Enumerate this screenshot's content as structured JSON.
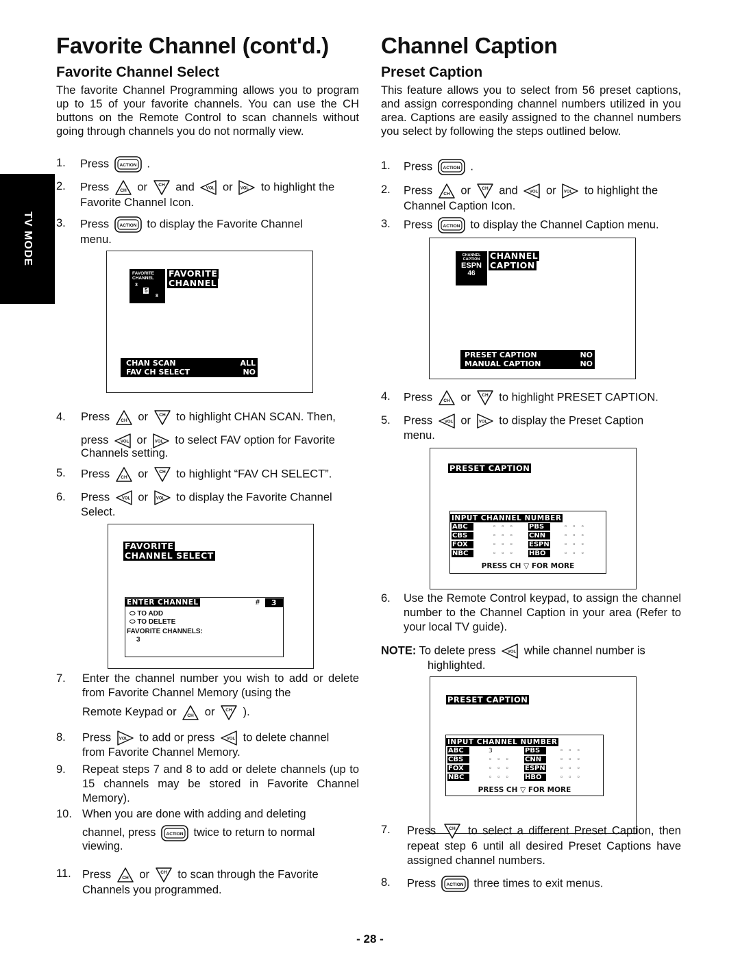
{
  "side_tab": {
    "label": "TV MODE"
  },
  "left": {
    "title": "Favorite Channel (cont'd.)",
    "subtitle": "Favorite Channel Select",
    "intro": "The favorite Channel Programming allows you to program up to 15 of your favorite channels. You can use the CH buttons on the Remote Control to scan channels without going through channels you do not normally view.",
    "steps": {
      "s1": {
        "num": "1.",
        "a": "Press",
        "b": "."
      },
      "s2": {
        "num": "2.",
        "a": "Press",
        "or1": "or",
        "and": "and",
        "or2": "or",
        "b": "to highlight the",
        "c": "Favorite Channel Icon."
      },
      "s3": {
        "num": "3.",
        "a": "Press",
        "b": "to display the Favorite Channel",
        "c": "menu."
      },
      "s4": {
        "num": "4.",
        "a": "Press",
        "or1": "or",
        "b": "to highlight CHAN SCAN. Then,",
        "c": "press",
        "or2": "or",
        "d": "to select FAV option for Favorite",
        "e": "Channels setting."
      },
      "s5": {
        "num": "5.",
        "a": "Press",
        "or1": "or",
        "b": "to highlight “FAV CH SELECT”."
      },
      "s6": {
        "num": "6.",
        "a": "Press",
        "or1": "or",
        "b": "to display the Favorite Channel",
        "c": "Select."
      },
      "s7": {
        "num": "7.",
        "a": "Enter the channel number you wish to add or delete from Favorite Channel Memory (using the",
        "b": "Remote Keypad or",
        "or1": "or",
        "c": ")."
      },
      "s8": {
        "num": "8.",
        "a": "Press",
        "b": "to add or press",
        "c": "to delete channel",
        "d": "from Favorite Channel Memory."
      },
      "s9": {
        "num": "9.",
        "a": "Repeat steps 7 and 8 to add or delete channels (up to 15 channels may be stored in Favorite Channel Memory)."
      },
      "s10": {
        "num": "10.",
        "a": "When you are done with adding and deleting",
        "b": "channel, press",
        "c": "twice to return to normal",
        "d": "viewing."
      },
      "s11": {
        "num": "11.",
        "a": "Press",
        "or1": "or",
        "b": "to scan through the Favorite",
        "c": "Channels you programmed."
      }
    },
    "screen1": {
      "icon_line1": "FAVORITE",
      "icon_line2": "CHANNEL",
      "icon_nums": [
        "3",
        "5",
        "8"
      ],
      "title_line1": "FAVORITE",
      "title_line2": "CHANNEL",
      "rows": [
        {
          "label": "CHAN SCAN",
          "value": "ALL"
        },
        {
          "label": "FAV CH SELECT",
          "value": "NO"
        }
      ]
    },
    "screen2": {
      "title_line1": "FAVORITE",
      "title_line2": "CHANNEL SELECT",
      "enter_label": "ENTER CHANNEL",
      "hash": "#",
      "channel": "3",
      "add_label": "TO ADD",
      "delete_label": "TO DELETE",
      "fav_label": "FAVORITE CHANNELS:",
      "fav_value": "3"
    }
  },
  "right": {
    "title": "Channel Caption",
    "subtitle": "Preset Caption",
    "intro": "This feature allows you to select from 56 preset captions, and assign corresponding channel numbers utilized in you area. Captions are easily assigned to the channel numbers you select by following the steps outlined below.",
    "steps": {
      "s1": {
        "num": "1.",
        "a": "Press",
        "b": "."
      },
      "s2": {
        "num": "2.",
        "a": "Press",
        "or1": "or",
        "and": "and",
        "or2": "or",
        "b": "to highlight the",
        "c": "Channel Caption Icon."
      },
      "s3": {
        "num": "3.",
        "a": "Press",
        "b": "to display the Channel Caption menu."
      },
      "s4": {
        "num": "4.",
        "a": "Press",
        "or1": "or",
        "b": "to highlight PRESET CAPTION."
      },
      "s5": {
        "num": "5.",
        "a": "Press",
        "or1": "or",
        "b": "to display the Preset Caption",
        "c": "menu."
      },
      "s6": {
        "num": "6.",
        "a": "Use the Remote Control keypad, to assign the channel number to the Channel Caption in your area (Refer to your local TV guide)."
      },
      "note": {
        "label": "NOTE:",
        "a": "To delete press",
        "b": "while channel number is",
        "c": "highlighted."
      },
      "s7": {
        "num": "7.",
        "a": "Press",
        "b": "to select a different Preset Caption,",
        "c": "then repeat step 6 until all desired Preset Captions have assigned channel numbers."
      },
      "s8": {
        "num": "8.",
        "a": "Press",
        "b": "three times to exit menus."
      }
    },
    "screen1": {
      "icon_line1": "CHANNEL",
      "icon_line2": "CAPTION",
      "icon_station": "ESPN",
      "icon_channel": "46",
      "title_line1": "CHANNEL",
      "title_line2": "CAPTION",
      "rows": [
        {
          "label": "PRESET CAPTION",
          "value": "NO"
        },
        {
          "label": "MANUAL CAPTION",
          "value": "NO"
        }
      ]
    },
    "screen2": {
      "title": "PRESET CAPTION",
      "table_header": "INPUT CHANNEL NUMBER",
      "left_col": [
        {
          "station": "ABC",
          "value": "◦◦◦"
        },
        {
          "station": "CBS",
          "value": "◦◦◦"
        },
        {
          "station": "FOX",
          "value": "◦◦◦"
        },
        {
          "station": "NBC",
          "value": "◦◦◦"
        }
      ],
      "right_col": [
        {
          "station": "PBS",
          "value": "◦◦◦"
        },
        {
          "station": "CNN",
          "value": "◦◦◦"
        },
        {
          "station": "ESPN",
          "value": "◦◦◦"
        },
        {
          "station": "HBO",
          "value": "◦◦◦"
        }
      ],
      "footer_a": "PRESS CH",
      "footer_b": "FOR MORE"
    },
    "screen3": {
      "title": "PRESET CAPTION",
      "table_header": "INPUT CHANNEL NUMBER",
      "left_col": [
        {
          "station": "ABC",
          "value": "3"
        },
        {
          "station": "CBS",
          "value": "◦◦◦"
        },
        {
          "station": "FOX",
          "value": "◦◦◦"
        },
        {
          "station": "NBC",
          "value": "◦◦◦"
        }
      ],
      "right_col": [
        {
          "station": "PBS",
          "value": "◦◦◦"
        },
        {
          "station": "CNN",
          "value": "◦◦◦"
        },
        {
          "station": "ESPN",
          "value": "◦◦◦"
        },
        {
          "station": "HBO",
          "value": "◦◦◦"
        }
      ],
      "footer_a": "PRESS CH",
      "footer_b": "FOR MORE"
    }
  },
  "footer": {
    "page_number": "- 28 -"
  },
  "icons": {
    "action": "ACTION",
    "ch": "CH",
    "vol": "VOL"
  }
}
